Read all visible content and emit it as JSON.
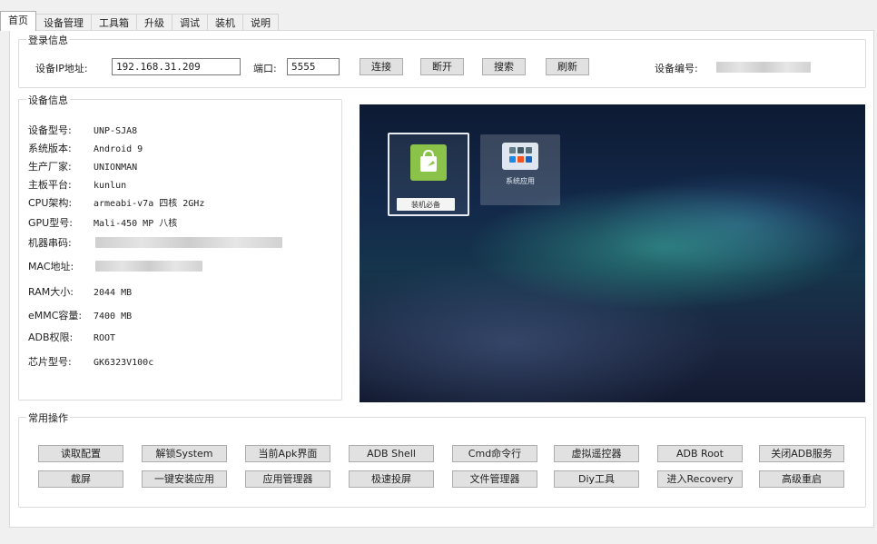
{
  "tabs": [
    {
      "label": "首页",
      "active": true
    },
    {
      "label": "设备管理"
    },
    {
      "label": "工具箱"
    },
    {
      "label": "升级"
    },
    {
      "label": "调试"
    },
    {
      "label": "装机"
    },
    {
      "label": "说明"
    }
  ],
  "login": {
    "title": "登录信息",
    "ip_label": "设备IP地址:",
    "ip_value": "192.168.31.209",
    "port_label": "端口:",
    "port_value": "5555",
    "connect": "连接",
    "disconnect": "断开",
    "search": "搜索",
    "refresh": "刷新",
    "serial_label": "设备编号:"
  },
  "device": {
    "title": "设备信息",
    "rows": [
      {
        "k": "设备型号:",
        "v": "UNP-SJA8"
      },
      {
        "k": "系统版本:",
        "v": "Android 9"
      },
      {
        "k": "生产厂家:",
        "v": "UNIONMAN"
      },
      {
        "k": "主板平台:",
        "v": "kunlun"
      },
      {
        "k": "CPU架构:",
        "v": "armeabi-v7a 四核 2GHz"
      },
      {
        "k": "GPU型号:",
        "v": "Mali-450 MP 八核"
      },
      {
        "k": "机器串码:",
        "v": ""
      },
      {
        "k": "MAC地址:",
        "v": ""
      },
      {
        "k": "RAM大小:",
        "v": "2044 MB"
      },
      {
        "k": "eMMC容量:",
        "v": "7400 MB"
      },
      {
        "k": "ADB权限:",
        "v": "ROOT"
      },
      {
        "k": "芯片型号:",
        "v": "GK6323V100c"
      }
    ]
  },
  "screen": {
    "apps": [
      {
        "label": "装机必备"
      },
      {
        "label": "系统应用"
      }
    ]
  },
  "ops": {
    "title": "常用操作",
    "row1": [
      "读取配置",
      "解锁System",
      "当前Apk界面",
      "ADB Shell",
      "Cmd命令行",
      "虚拟遥控器",
      "ADB  Root",
      "关闭ADB服务"
    ],
    "row2": [
      "截屏",
      "一键安装应用",
      "应用管理器",
      "极速投屏",
      "文件管理器",
      "Diy工具",
      "进入Recovery",
      "高级重启"
    ]
  },
  "colors": {
    "app_green": "#8bc34a",
    "accent_blue": "#1e88e5"
  }
}
